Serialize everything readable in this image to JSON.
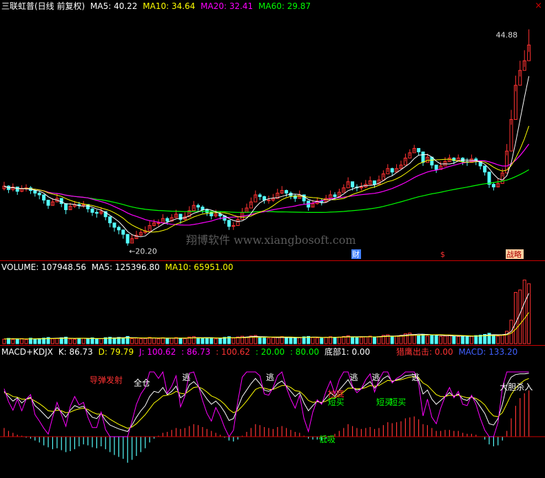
{
  "colors": {
    "bg": "#000000",
    "up": "#ff3232",
    "down": "#54fcfc",
    "ma5": "#ffffff",
    "ma10": "#ffff00",
    "ma20": "#ff00ff",
    "ma60": "#00ff00",
    "divider": "#c00000",
    "macd_pos": "#ff3232",
    "macd_neg": "#54fcfc",
    "k": "#ffffff",
    "d": "#ffff00",
    "j": "#ff00ff"
  },
  "main_legend": {
    "title": "三联虹普(日线 前复权)",
    "ma5": "MA5: 40.22",
    "ma10": "MA10: 34.64",
    "ma20": "MA20: 32.41",
    "ma60": "MA60: 29.87"
  },
  "volume_legend": {
    "vol": "VOLUME: 107948.56",
    "ma5": "MA5: 125396.80",
    "ma10": "MA10: 65951.00"
  },
  "ind_legend": {
    "name": "MACD+KDJX",
    "k": "K: 86.73",
    "d": "D: 79.79",
    "j": "J: 100.62",
    "v1": ": 86.73",
    "v2": ": 100.62",
    "v3": ": 20.00",
    "v4": ": 80.00",
    "bottom": "底部1: 0.00",
    "eagle": "猎鹰出击: 0.00",
    "macd": "MACD: 133.20"
  },
  "close_icon": "×",
  "chart_data": [
    {
      "type": "candlestick",
      "title": "三联虹普(日线 前复权)",
      "high_label": "44.88",
      "low_label": "20.20",
      "watermark": "翔博软件 www.xiangbosoft.com",
      "event_markers": [
        "财",
        "$",
        "战略"
      ],
      "close": [
        27.0,
        26.6,
        26.9,
        26.4,
        26.7,
        26.8,
        26.5,
        26.2,
        26.0,
        25.4,
        24.8,
        25.2,
        25.6,
        25.0,
        24.3,
        24.7,
        24.9,
        24.8,
        24.9,
        24.4,
        24.0,
        23.9,
        24.1,
        23.5,
        22.8,
        22.3,
        22.0,
        21.5,
        20.5,
        21.0,
        21.4,
        21.7,
        21.9,
        22.5,
        22.8,
        22.8,
        23.3,
        23.0,
        23.4,
        23.8,
        23.2,
        23.5,
        24.2,
        24.8,
        24.6,
        24.3,
        24.0,
        23.6,
        23.8,
        23.6,
        23.1,
        22.4,
        22.5,
        23.2,
        24.0,
        24.5,
        25.2,
        26.0,
        25.8,
        25.4,
        25.4,
        25.6,
        26.2,
        26.5,
        26.2,
        25.9,
        25.6,
        26.0,
        25.3,
        24.6,
        25.0,
        25.3,
        25.2,
        25.6,
        26.0,
        25.8,
        26.3,
        26.8,
        27.5,
        26.9,
        26.8,
        26.9,
        27.2,
        27.6,
        27.2,
        27.7,
        28.4,
        29.0,
        28.6,
        29.0,
        29.4,
        30.2,
        30.8,
        31.3,
        30.9,
        29.7,
        30.3,
        29.4,
        28.9,
        29.3,
        29.8,
        30.2,
        29.9,
        30.2,
        29.8,
        29.7,
        30.1,
        29.8,
        29.3,
        28.6,
        27.2,
        26.9,
        27.3,
        28.5,
        31.0,
        34.6,
        38.5,
        40.2,
        41.3,
        43.1
      ],
      "high": [
        27.5,
        27.1,
        27.3,
        26.9,
        27.1,
        27.2,
        27.0,
        26.7,
        26.4,
        26.0,
        25.3,
        25.6,
        26.1,
        25.5,
        24.8,
        25.1,
        25.3,
        25.2,
        25.3,
        24.9,
        24.5,
        24.3,
        24.6,
        24.0,
        23.3,
        22.8,
        22.5,
        22.0,
        21.1,
        21.5,
        21.9,
        22.1,
        22.4,
        23.0,
        23.2,
        23.2,
        23.8,
        23.5,
        23.8,
        24.3,
        23.7,
        24.0,
        24.7,
        25.3,
        25.0,
        24.8,
        24.4,
        24.1,
        24.3,
        24.1,
        23.6,
        22.9,
        22.9,
        23.6,
        24.5,
        25.0,
        25.7,
        26.5,
        26.2,
        25.9,
        25.9,
        26.1,
        26.7,
        27.0,
        26.6,
        26.4,
        26.1,
        26.5,
        25.8,
        25.1,
        25.4,
        25.7,
        25.6,
        26.0,
        26.5,
        26.3,
        26.7,
        27.2,
        28.0,
        27.4,
        27.2,
        27.4,
        27.7,
        28.1,
        27.6,
        28.2,
        28.8,
        29.5,
        29.1,
        29.5,
        29.9,
        30.7,
        31.2,
        31.7,
        31.3,
        30.2,
        30.7,
        29.9,
        29.4,
        29.8,
        30.3,
        30.6,
        30.3,
        30.6,
        30.3,
        30.2,
        30.6,
        30.3,
        29.8,
        29.1,
        27.7,
        27.4,
        27.9,
        29.0,
        31.8,
        35.7,
        39.6,
        41.3,
        42.5,
        44.88
      ],
      "low": [
        26.5,
        26.2,
        26.4,
        26.0,
        26.3,
        26.4,
        26.1,
        25.8,
        25.5,
        25.0,
        24.4,
        24.8,
        25.2,
        24.6,
        23.8,
        24.3,
        24.5,
        24.4,
        24.5,
        24.0,
        23.6,
        23.4,
        23.7,
        23.1,
        22.3,
        21.8,
        21.5,
        21.0,
        20.2,
        20.6,
        21.0,
        21.3,
        21.5,
        22.1,
        22.4,
        22.4,
        22.9,
        22.6,
        23.0,
        23.4,
        22.7,
        23.1,
        23.8,
        24.4,
        24.2,
        23.9,
        23.6,
        23.2,
        23.4,
        23.2,
        22.7,
        22.0,
        22.0,
        22.8,
        23.6,
        24.1,
        24.8,
        25.6,
        25.4,
        25.0,
        25.0,
        25.2,
        25.8,
        26.1,
        25.8,
        25.5,
        25.2,
        25.6,
        24.9,
        24.2,
        24.6,
        24.9,
        24.8,
        25.2,
        25.6,
        25.4,
        25.9,
        26.4,
        27.1,
        26.5,
        26.4,
        26.5,
        26.8,
        27.2,
        26.8,
        27.3,
        28.0,
        28.6,
        28.2,
        28.6,
        29.0,
        29.8,
        30.4,
        30.9,
        30.5,
        29.3,
        29.9,
        29.0,
        28.5,
        28.9,
        29.4,
        29.8,
        29.5,
        29.8,
        29.4,
        29.3,
        29.7,
        29.4,
        28.9,
        28.2,
        26.8,
        26.5,
        26.9,
        28.1,
        30.5,
        34.0,
        37.8,
        39.5,
        40.6,
        42.3
      ],
      "yrange": [
        19.0,
        46.5
      ]
    },
    {
      "type": "bar",
      "title": "VOLUME",
      "values": [
        5.2,
        6.1,
        4.8,
        5.5,
        5.9,
        4.7,
        6.3,
        5.0,
        5.8,
        6.4,
        7.1,
        5.6,
        6.0,
        6.8,
        7.5,
        5.4,
        5.1,
        5.9,
        6.2,
        5.5,
        6.7,
        5.3,
        5.8,
        6.9,
        7.4,
        6.6,
        7.2,
        6.1,
        8.3,
        5.9,
        6.4,
        5.7,
        6.0,
        7.2,
        6.5,
        5.6,
        6.8,
        5.4,
        6.2,
        7.0,
        6.3,
        5.8,
        7.6,
        8.1,
        6.7,
        5.9,
        6.2,
        6.8,
        5.6,
        6.1,
        7.3,
        8.0,
        6.4,
        7.7,
        8.5,
        7.2,
        8.8,
        9.4,
        7.1,
        6.5,
        6.3,
        6.9,
        7.5,
        8.1,
        6.8,
        6.2,
        6.6,
        7.0,
        7.9,
        8.3,
        7.1,
        6.5,
        6.2,
        7.4,
        8.0,
        6.9,
        7.6,
        8.2,
        9.1,
        7.7,
        6.9,
        7.2,
        7.8,
        8.6,
        7.3,
        8.1,
        9.5,
        10.2,
        8.4,
        8.9,
        9.6,
        11.3,
        12.1,
        10.4,
        9.2,
        10.8,
        8.7,
        9.9,
        9.1,
        8.3,
        8.8,
        9.4,
        8.6,
        8.2,
        8.9,
        7.8,
        8.4,
        9.3,
        9.8,
        10.6,
        11.9,
        10.1,
        8.7,
        9.6,
        14.2,
        26.8,
        58.4,
        61.2,
        72.5,
        68.3
      ],
      "ma5": [
        5.5,
        5.6,
        5.7,
        5.6,
        5.5,
        5.4,
        5.5,
        5.6,
        5.7,
        5.8,
        6.1,
        6.1,
        6.3,
        6.4,
        6.6,
        6.2,
        6.0,
        6.2,
        6.2,
        5.9,
        5.9,
        5.9,
        5.8,
        6.1,
        6.4,
        6.4,
        6.8,
        6.9,
        7.1,
        6.8,
        6.8,
        6.5,
        6.3,
        6.6,
        6.4,
        6.3,
        6.5,
        6.2,
        6.3,
        6.3,
        6.2,
        6.3,
        6.6,
        6.9,
        7.0,
        6.9,
        7.0,
        6.9,
        6.6,
        6.2,
        6.5,
        6.9,
        6.8,
        7.0,
        7.2,
        7.6,
        8.0,
        8.3,
        8.1,
        7.9,
        7.7,
        7.4,
        7.0,
        7.1,
        7.0,
        7.0,
        7.0,
        6.9,
        7.1,
        7.4,
        7.5,
        7.5,
        7.2,
        7.1,
        7.2,
        7.2,
        7.4,
        7.8,
        8.0,
        7.9,
        7.9,
        8.0,
        8.0,
        8.1,
        7.8,
        8.0,
        8.4,
        8.9,
        8.7,
        8.9,
        9.3,
        9.8,
        10.4,
        10.4,
        10.9,
        10.7,
        10.6,
        10.2,
        9.8,
        9.5,
        9.2,
        9.1,
        8.8,
        8.7,
        8.8,
        8.6,
        8.4,
        8.7,
        8.9,
        9.4,
        10.1,
        10.3,
        10.2,
        10.3,
        10.9,
        13.9,
        23.5,
        34.3,
        46.6,
        57.4
      ],
      "ma10": [
        5.5,
        5.5,
        5.6,
        5.6,
        5.6,
        5.5,
        5.6,
        5.6,
        5.6,
        5.7,
        5.8,
        5.9,
        6.0,
        6.1,
        6.2,
        6.2,
        6.1,
        6.2,
        6.3,
        6.2,
        6.1,
        6.0,
        6.0,
        6.1,
        6.2,
        6.2,
        6.3,
        6.4,
        6.6,
        6.6,
        6.6,
        6.6,
        6.6,
        6.7,
        6.6,
        6.5,
        6.6,
        6.5,
        6.4,
        6.5,
        6.4,
        6.4,
        6.5,
        6.6,
        6.7,
        6.6,
        6.6,
        6.6,
        6.6,
        6.6,
        6.7,
        6.8,
        6.7,
        6.7,
        6.8,
        7.0,
        7.2,
        7.3,
        7.3,
        7.4,
        7.5,
        7.6,
        7.6,
        7.7,
        7.6,
        7.6,
        7.4,
        7.2,
        7.1,
        7.2,
        7.3,
        7.2,
        7.1,
        7.1,
        7.1,
        7.3,
        7.4,
        7.5,
        7.7,
        7.6,
        7.7,
        7.8,
        7.8,
        7.9,
        7.8,
        7.8,
        8.0,
        8.3,
        8.4,
        8.5,
        8.6,
        8.9,
        9.4,
        9.6,
        9.7,
        9.9,
        10.0,
        10.2,
        10.2,
        10.2,
        10.1,
        10.0,
        9.7,
        9.5,
        9.3,
        9.1,
        8.9,
        8.9,
        8.9,
        9.1,
        9.2,
        9.3,
        9.4,
        9.6,
        10.1,
        11.9,
        16.5,
        22.3,
        28.6,
        35.5
      ],
      "yrange": [
        0,
        80
      ]
    },
    {
      "type": "bar",
      "title": "MACD+KDJX",
      "macd": [
        0.9,
        0.6,
        0.4,
        0.2,
        0.1,
        -0.1,
        -0.2,
        -0.4,
        -0.6,
        -0.9,
        -1.1,
        -1.3,
        -1.2,
        -1.4,
        -1.6,
        -1.5,
        -1.3,
        -1.0,
        -0.8,
        -0.9,
        -1.1,
        -1.2,
        -1.0,
        -1.3,
        -1.6,
        -1.9,
        -2.1,
        -2.3,
        -2.7,
        -2.4,
        -2.0,
        -1.6,
        -1.2,
        -0.6,
        -0.2,
        0.1,
        0.4,
        0.5,
        0.7,
        0.9,
        0.8,
        0.9,
        1.1,
        1.3,
        1.2,
        1.0,
        0.8,
        0.6,
        0.4,
        0.2,
        -0.1,
        -0.4,
        -0.5,
        -0.3,
        0.1,
        0.5,
        0.9,
        1.3,
        1.2,
        1.0,
        0.9,
        0.8,
        1.0,
        1.1,
        0.9,
        0.7,
        0.5,
        0.4,
        0.1,
        -0.2,
        -0.3,
        -0.3,
        -0.4,
        -0.2,
        0.1,
        0.3,
        0.6,
        0.9,
        1.3,
        1.1,
        0.9,
        0.8,
        0.9,
        1.0,
        0.8,
        0.9,
        1.2,
        1.5,
        1.4,
        1.5,
        1.6,
        1.9,
        2.0,
        2.1,
        1.8,
        1.3,
        1.2,
        0.9,
        0.6,
        0.6,
        0.7,
        0.7,
        0.6,
        0.6,
        0.4,
        0.3,
        0.3,
        0.2,
        0.0,
        -0.3,
        -0.8,
        -1.0,
        -0.9,
        -0.4,
        0.6,
        1.9,
        3.2,
        4.0,
        4.5,
        4.8
      ],
      "k": [
        70,
        62,
        55,
        60,
        52,
        58,
        61,
        48,
        42,
        35,
        28,
        36,
        45,
        38,
        30,
        41,
        48,
        45,
        47,
        38,
        30,
        28,
        36,
        25,
        18,
        15,
        12,
        10,
        8,
        18,
        30,
        40,
        48,
        62,
        70,
        68,
        76,
        65,
        70,
        78,
        60,
        65,
        80,
        85,
        78,
        68,
        58,
        50,
        55,
        48,
        38,
        25,
        28,
        45,
        62,
        72,
        82,
        90,
        82,
        72,
        70,
        74,
        82,
        86,
        78,
        70,
        62,
        68,
        52,
        40,
        48,
        55,
        52,
        60,
        68,
        62,
        72,
        80,
        88,
        76,
        72,
        74,
        80,
        85,
        75,
        82,
        90,
        94,
        85,
        88,
        90,
        94,
        95,
        96,
        88,
        66,
        72,
        58,
        50,
        56,
        62,
        68,
        62,
        66,
        58,
        56,
        62,
        56,
        46,
        36,
        20,
        18,
        28,
        50,
        80,
        92,
        96,
        97,
        97,
        98
      ],
      "d": [
        68,
        66,
        62,
        61,
        58,
        58,
        59,
        55,
        51,
        46,
        40,
        39,
        41,
        40,
        37,
        38,
        41,
        43,
        44,
        42,
        38,
        35,
        35,
        32,
        27,
        23,
        19,
        16,
        13,
        15,
        20,
        27,
        34,
        43,
        52,
        57,
        63,
        64,
        66,
        70,
        67,
        66,
        71,
        76,
        77,
        74,
        69,
        63,
        60,
        56,
        50,
        42,
        37,
        40,
        47,
        55,
        64,
        73,
        76,
        75,
        73,
        73,
        76,
        79,
        79,
        76,
        71,
        70,
        64,
        56,
        53,
        54,
        53,
        55,
        59,
        60,
        64,
        69,
        75,
        75,
        74,
        74,
        76,
        79,
        78,
        79,
        83,
        87,
        86,
        87,
        88,
        90,
        92,
        93,
        91,
        83,
        79,
        72,
        65,
        62,
        62,
        64,
        63,
        64,
        62,
        60,
        61,
        59,
        55,
        49,
        39,
        32,
        31,
        37,
        51,
        65,
        75,
        82,
        87,
        90
      ],
      "j": [
        74,
        54,
        41,
        58,
        40,
        58,
        65,
        34,
        24,
        13,
        4,
        30,
        53,
        34,
        16,
        47,
        62,
        49,
        53,
        30,
        14,
        14,
        38,
        11,
        0,
        0,
        0,
        0,
        0,
        24,
        50,
        66,
        76,
        100,
        100,
        90,
        100,
        67,
        78,
        94,
        46,
        63,
        98,
        100,
        80,
        56,
        36,
        24,
        45,
        32,
        14,
        0,
        10,
        55,
        92,
        100,
        100,
        100,
        94,
        66,
        64,
        76,
        94,
        100,
        76,
        58,
        44,
        64,
        28,
        8,
        38,
        57,
        50,
        70,
        86,
        66,
        88,
        100,
        100,
        78,
        68,
        74,
        88,
        97,
        69,
        88,
        100,
        100,
        83,
        90,
        94,
        100,
        100,
        100,
        82,
        32,
        58,
        30,
        20,
        44,
        62,
        76,
        60,
        70,
        50,
        48,
        64,
        50,
        28,
        10,
        0,
        0,
        22,
        76,
        100,
        100,
        100,
        100,
        100,
        100
      ],
      "labels": [
        "导弹发射",
        "全仓",
        "逃",
        "逃",
        "逃",
        "逃",
        "逃",
        "抄底",
        "短买",
        "短买",
        "短买",
        "低吸",
        "大胆杀入"
      ]
    }
  ]
}
